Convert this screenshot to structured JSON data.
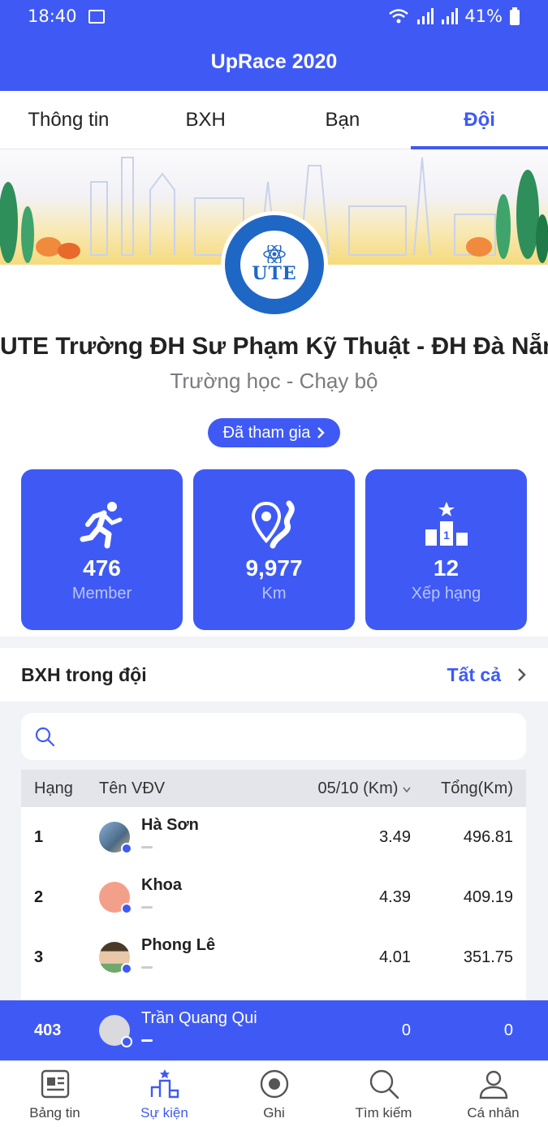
{
  "status_bar": {
    "time": "18:40",
    "battery": "41%"
  },
  "app_bar": {
    "title": "UpRace 2020"
  },
  "tabs": [
    {
      "label": "Thông tin",
      "active": false
    },
    {
      "label": "BXH",
      "active": false
    },
    {
      "label": "Bạn",
      "active": false
    },
    {
      "label": "Đội",
      "active": true
    }
  ],
  "team": {
    "logo_text": "UTE",
    "name": "UTE Trường ĐH Sư Phạm Kỹ Thuật - ĐH Đà Nẵng",
    "subtitle": "Trường học - Chạy bộ",
    "joined_label": "Đã tham gia",
    "stats": [
      {
        "icon": "runner-icon",
        "value": "476",
        "label": "Member"
      },
      {
        "icon": "route-pin-icon",
        "value": "9,977",
        "label": "Km"
      },
      {
        "icon": "podium-icon",
        "value": "12",
        "label": "Xếp hạng"
      }
    ]
  },
  "leaderboard": {
    "title": "BXH trong đội",
    "see_all": "Tất cả",
    "search_placeholder": "",
    "headers": {
      "rank": "Hạng",
      "name": "Tên VĐV",
      "day": "05/10 (Km)",
      "total": "Tổng(Km)"
    },
    "rows": [
      {
        "rank": "1",
        "name": "Hà Sơn",
        "day": "3.49",
        "total": "496.81"
      },
      {
        "rank": "2",
        "name": "Khoa",
        "day": "4.39",
        "total": "409.19"
      },
      {
        "rank": "3",
        "name": "Phong Lê",
        "day": "4.01",
        "total": "351.75"
      }
    ],
    "me": {
      "rank": "403",
      "name": "Trần Quang Qui",
      "day": "0",
      "total": "0"
    }
  },
  "colors": {
    "accent": "#3f5af4",
    "background": "#f2f3f7"
  },
  "bottom_nav": [
    {
      "label": "Bảng tin",
      "icon": "newspaper-icon",
      "active": false
    },
    {
      "label": "Sự kiện",
      "icon": "event-podium-icon",
      "active": true
    },
    {
      "label": "Ghi",
      "icon": "record-icon",
      "active": false
    },
    {
      "label": "Tìm kiếm",
      "icon": "search-icon",
      "active": false
    },
    {
      "label": "Cá nhân",
      "icon": "user-icon",
      "active": false
    }
  ]
}
